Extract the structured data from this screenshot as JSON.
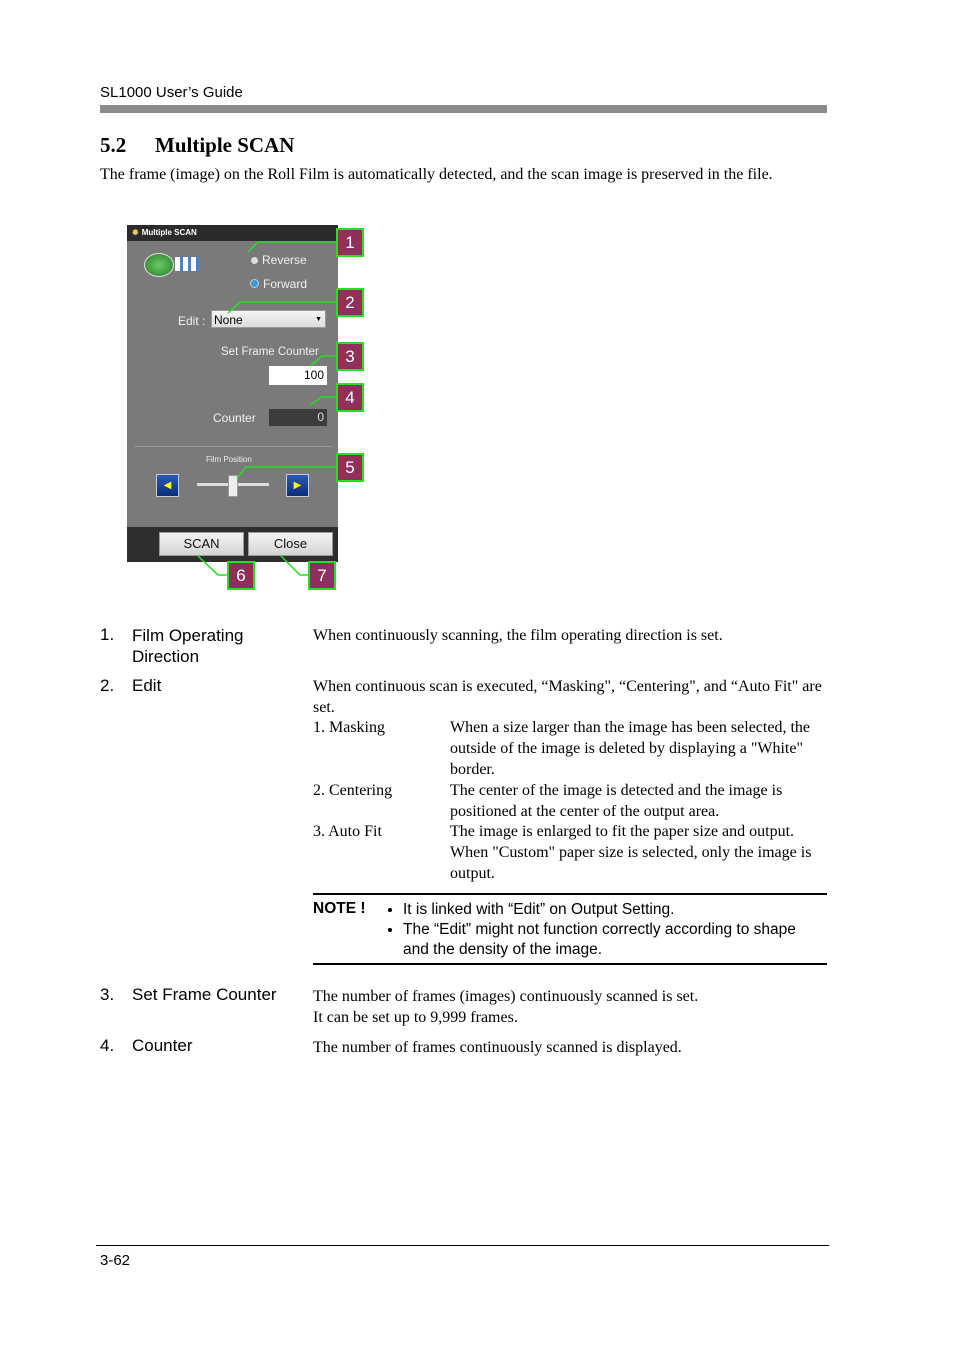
{
  "header": {
    "title": "SL1000 User’s Guide"
  },
  "section": {
    "number": "5.2",
    "title": "Multiple SCAN",
    "intro": "The frame (image) on the Roll Film is automatically detected, and the scan image is preserved in the file."
  },
  "panel": {
    "title": "Multiple SCAN",
    "reverse": "Reverse",
    "forward": "Forward",
    "selected_direction": "Forward",
    "edit_label": "Edit :",
    "edit_value": "None",
    "set_frame_counter_label": "Set Frame Counter",
    "set_frame_counter_value": "100",
    "counter_label": "Counter",
    "counter_value": "0",
    "film_position_label": "Film Position",
    "scan_button": "SCAN",
    "close_button": "Close",
    "accent": "#22e022",
    "callout_color": "#8e2f5c",
    "callouts": [
      "1",
      "2",
      "3",
      "4",
      "5",
      "6",
      "7"
    ]
  },
  "items": [
    {
      "num": "1.",
      "label": "Film Operating Direction",
      "desc": "When continuously scanning, the film operating direction is set."
    },
    {
      "num": "2.",
      "label": "Edit",
      "desc": "When continuous scan is executed, “Masking\", “Centering\", and “Auto Fit\" are set.",
      "sub": [
        {
          "name": "1. Masking",
          "desc": "When a size larger than the image has been selected, the outside of the image is deleted by displaying a \"White\" border."
        },
        {
          "name": "2. Centering",
          "desc": "The center of the image is detected and the image is positioned at the center of the output area."
        },
        {
          "name": "3. Auto Fit",
          "desc": "The image is enlarged to fit the paper size and output.   When \"Custom\" paper size is selected, only the image is output."
        }
      ],
      "note": {
        "label": "NOTE !",
        "bullets": [
          "It is linked with “Edit” on Output Setting.",
          "The “Edit” might not function correctly according to shape and the density of the image."
        ]
      }
    },
    {
      "num": "3.",
      "label": "Set Frame Counter",
      "desc": "The number of frames (images) continuously scanned is set.",
      "desc2": "It can be set up to 9,999 frames."
    },
    {
      "num": "4.",
      "label": "Counter",
      "desc": "The number of frames continuously scanned is displayed."
    }
  ],
  "footer": {
    "page": "3-62"
  }
}
